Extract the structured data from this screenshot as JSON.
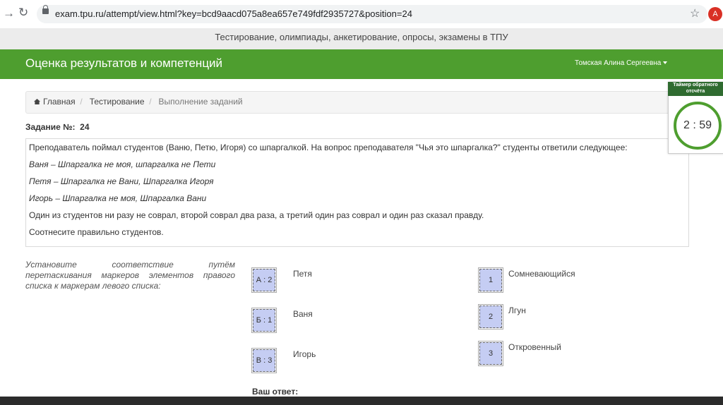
{
  "browser": {
    "url": "exam.tpu.ru/attempt/view.html?key=bcd9aacd075a8ea657e749fdf2935727&position=24",
    "avatar_letter": "A"
  },
  "banner": "Тестирование, олимпиады, анкетирование, опросы, экзамены в ТПУ",
  "navbar": {
    "brand": "Оценка результатов и компетенций",
    "user": "Томская Алина Сергеевна"
  },
  "breadcrumb": {
    "home": "Главная",
    "item1": "Тестирование",
    "item2": "Выполнение заданий"
  },
  "task": {
    "label": "Задание №:",
    "number": "24",
    "lines": [
      "Преподаватель поймал студентов (Ваню, Петю, Игоря) со шпаргалкой. На вопрос преподавателя \"Чья это шпаргалка?\" студенты ответили следующее:",
      "Ваня – Шпаргалка не моя, шпаргалка не Пети",
      "Петя – Шпаргалка не Вани, Шпаргалка Игоря",
      "Игорь – Шпаргалка не моя, Шпаргалка Вани",
      "Один из студентов ни разу не соврал, второй соврал два раза, а третий один раз соврал и один раз сказал правду.",
      "Соотнесите правильно студентов."
    ]
  },
  "instruction": "Установите соответствие путём перетаскивания маркеров элементов правого списка к маркерам левого списка:",
  "left_list": [
    {
      "marker": "А : 2",
      "label": "Петя"
    },
    {
      "marker": "Б : 1",
      "label": "Ваня"
    },
    {
      "marker": "В : 3",
      "label": "Игорь"
    }
  ],
  "right_list": [
    {
      "marker": "1",
      "label": "Сомневающийся"
    },
    {
      "marker": "2",
      "label": "Лгун"
    },
    {
      "marker": "3",
      "label": "Откровенный"
    }
  ],
  "answer_label": "Ваш ответ:",
  "timer": {
    "title": "Таймер обратного отсчёта",
    "value": "2 : 59"
  },
  "colors": {
    "accent_green": "#4e9e2f",
    "marker_blue": "#c5cdf3"
  }
}
